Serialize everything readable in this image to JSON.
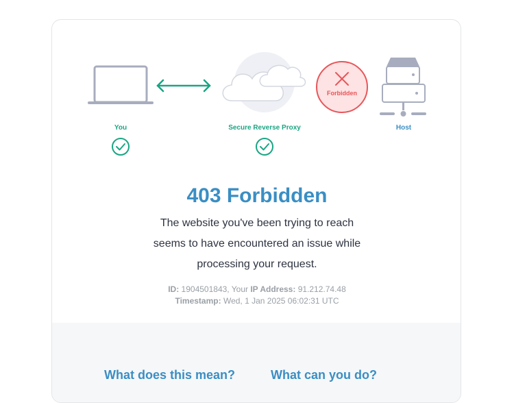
{
  "diagram": {
    "you_label": "You",
    "proxy_label": "Secure Reverse Proxy",
    "host_label": "Host",
    "forbidden_badge": "Forbidden"
  },
  "error": {
    "title": "403 Forbidden",
    "message_line1": "The website you've been trying to reach",
    "message_line2": "seems to have encountered an issue while",
    "message_line3": "processing your request."
  },
  "meta": {
    "id_label": "ID:",
    "id_value": "1904501843",
    "ip_prefix": ", Your ",
    "ip_label": "IP Address:",
    "ip_value": "91.212.74.48",
    "timestamp_label": "Timestamp:",
    "timestamp_value": "Wed, 1 Jan 2025 06:02:31 UTC"
  },
  "sections": {
    "meaning_heading": "What does this mean?",
    "action_heading": "What can you do?"
  },
  "colors": {
    "accent_blue": "#3a8ec4",
    "success_green": "#1aa583",
    "error_red": "#e8555a"
  }
}
